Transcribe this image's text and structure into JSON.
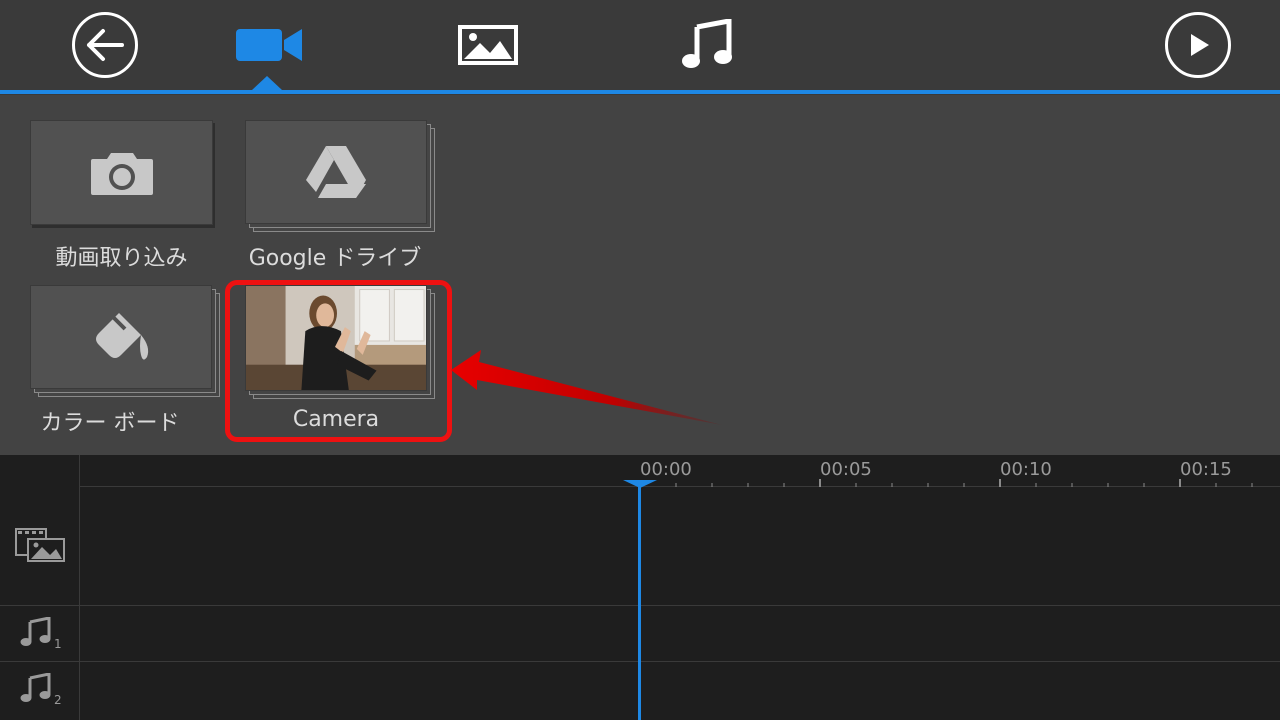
{
  "toolbar": {
    "back_icon": "arrow-left-icon",
    "tabs": [
      {
        "id": "video",
        "icon": "video-camera-icon",
        "active": true
      },
      {
        "id": "image",
        "icon": "image-icon",
        "active": false
      },
      {
        "id": "music",
        "icon": "music-note-icon",
        "active": false
      }
    ],
    "play_icon": "play-icon",
    "accent_color": "#1e88e5"
  },
  "library": {
    "items": [
      {
        "label": "動画取り込み",
        "icon": "camera-icon"
      },
      {
        "label": "Google ドライブ",
        "icon": "google-drive-icon"
      },
      {
        "label": "カラー ボード",
        "icon": "paint-bucket-icon"
      },
      {
        "label": "Camera",
        "icon": "video-thumbnail"
      }
    ],
    "highlight_color": "#ee1111"
  },
  "timeline": {
    "ticks": [
      "00:00",
      "00:05",
      "00:10",
      "00:15"
    ],
    "tracks": [
      {
        "icon": "video-image-track-icon",
        "number": ""
      },
      {
        "icon": "music-track-icon",
        "number": "1"
      },
      {
        "icon": "music-track-icon",
        "number": "2"
      }
    ]
  }
}
